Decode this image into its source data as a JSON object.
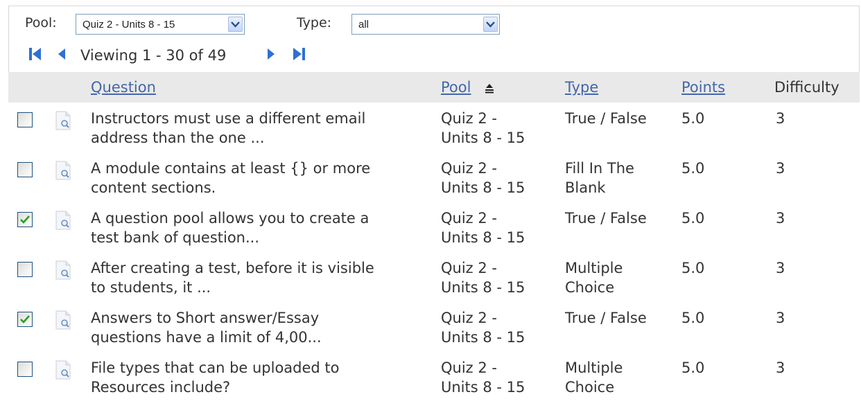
{
  "filters": {
    "pool_label": "Pool:",
    "pool_value": "Quiz 2 - Units 8 - 15",
    "type_label": "Type:",
    "type_value": "all"
  },
  "pager": {
    "text": "Viewing 1 - 30 of 49"
  },
  "columns": {
    "question": "Question",
    "pool": "Pool",
    "type": "Type",
    "points": "Points",
    "difficulty": "Difficulty"
  },
  "rows": [
    {
      "checked": false,
      "question": [
        "Instructors must use a different email",
        "address than the one ..."
      ],
      "pool": [
        "Quiz 2 -",
        "Units 8 - 15"
      ],
      "type": [
        "True / False",
        ""
      ],
      "points": "5.0",
      "difficulty": "3"
    },
    {
      "checked": false,
      "question": [
        "A module contains at least {} or more",
        "content sections."
      ],
      "pool": [
        "Quiz 2 -",
        "Units 8 - 15"
      ],
      "type": [
        "Fill In The",
        "Blank"
      ],
      "points": "5.0",
      "difficulty": "3"
    },
    {
      "checked": true,
      "question": [
        "A question pool allows you to create a",
        "test bank of question..."
      ],
      "pool": [
        "Quiz 2 -",
        "Units 8 - 15"
      ],
      "type": [
        "True / False",
        ""
      ],
      "points": "5.0",
      "difficulty": "3"
    },
    {
      "checked": false,
      "question": [
        "After creating a test, before it is visible",
        "to students, it ..."
      ],
      "pool": [
        "Quiz 2 -",
        "Units 8 - 15"
      ],
      "type": [
        "Multiple",
        "Choice"
      ],
      "points": "5.0",
      "difficulty": "3"
    },
    {
      "checked": true,
      "question": [
        "Answers to Short answer/Essay",
        "questions have a limit of 4,00..."
      ],
      "pool": [
        "Quiz 2 -",
        "Units 8 - 15"
      ],
      "type": [
        "True / False",
        ""
      ],
      "points": "5.0",
      "difficulty": "3"
    },
    {
      "checked": false,
      "question": [
        "File types that can be uploaded to",
        "Resources include?"
      ],
      "pool": [
        "Quiz 2 -",
        "Units 8 - 15"
      ],
      "type": [
        "Multiple",
        "Choice"
      ],
      "points": "5.0",
      "difficulty": "3"
    }
  ],
  "icons": {
    "pager_first": "first-page-icon",
    "pager_prev": "previous-page-icon",
    "pager_next": "next-page-icon",
    "pager_last": "last-page-icon",
    "sort": "sort-ascending-icon",
    "row_doc": "question-preview-icon",
    "dropdown": "chevron-down-icon"
  },
  "colors": {
    "link": "#4466aa",
    "header_bg": "#e9e9e9",
    "pager_arrow": "#2f6fd4",
    "check": "#21a121"
  }
}
